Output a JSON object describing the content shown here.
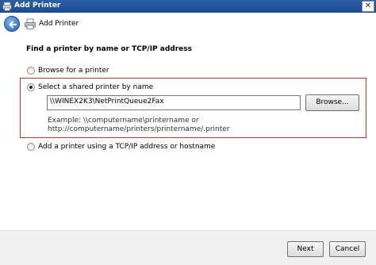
{
  "window": {
    "title": "Add Printer",
    "close_glyph": "✕"
  },
  "header": {
    "title": "Add Printer"
  },
  "main": {
    "heading": "Find a printer by name or TCP/IP address",
    "options": [
      {
        "label": "Browse for a printer",
        "checked": false
      },
      {
        "label": "Select a shared printer by name",
        "checked": true
      },
      {
        "label": "Add a printer using a TCP/IP address or hostname",
        "checked": false
      }
    ],
    "shared_printer_value": "\\\\WINEX2K3\\NetPrintQueue2Fax",
    "browse_label": "Browse...",
    "example_line1": "Example: \\\\computername\\printername or",
    "example_line2": "http://computername/printers/printername/.printer"
  },
  "footer": {
    "next_label": "Next",
    "cancel_label": "Cancel"
  },
  "colors": {
    "titlebar": "#1b4a8f",
    "highlight_border": "#d32f2f"
  },
  "icons": [
    "window-printer-icon",
    "close-icon",
    "back-arrow-icon",
    "printer-icon"
  ]
}
